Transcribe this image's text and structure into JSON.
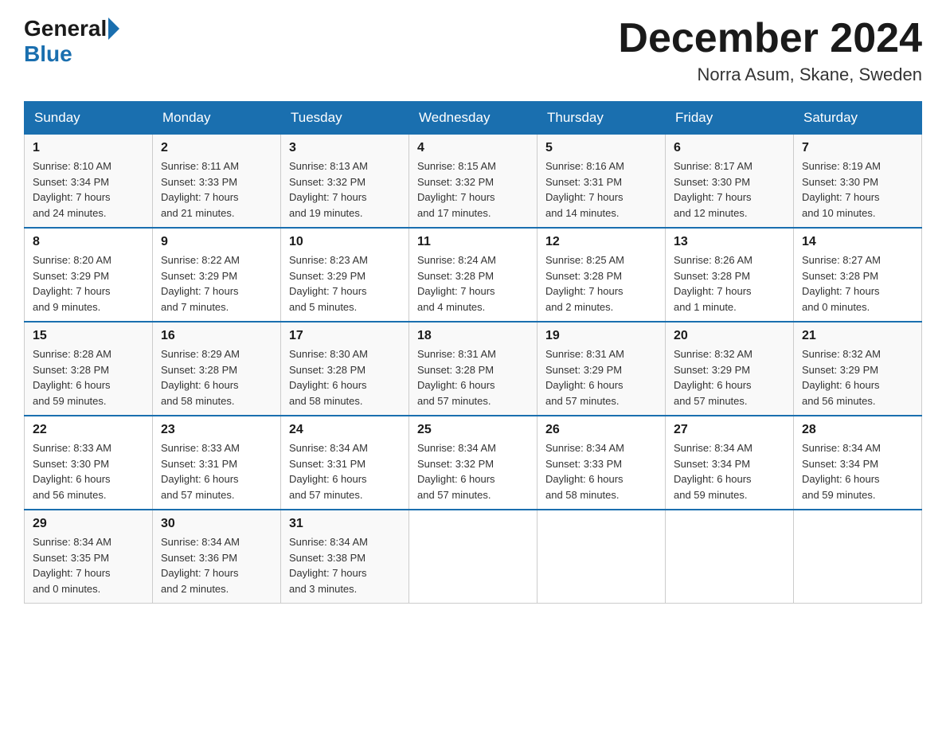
{
  "logo": {
    "general": "General",
    "blue": "Blue"
  },
  "title": "December 2024",
  "location": "Norra Asum, Skane, Sweden",
  "days_of_week": [
    "Sunday",
    "Monday",
    "Tuesday",
    "Wednesday",
    "Thursday",
    "Friday",
    "Saturday"
  ],
  "weeks": [
    [
      {
        "day": "1",
        "sunrise": "8:10 AM",
        "sunset": "3:34 PM",
        "daylight": "7 hours and 24 minutes."
      },
      {
        "day": "2",
        "sunrise": "8:11 AM",
        "sunset": "3:33 PM",
        "daylight": "7 hours and 21 minutes."
      },
      {
        "day": "3",
        "sunrise": "8:13 AM",
        "sunset": "3:32 PM",
        "daylight": "7 hours and 19 minutes."
      },
      {
        "day": "4",
        "sunrise": "8:15 AM",
        "sunset": "3:32 PM",
        "daylight": "7 hours and 17 minutes."
      },
      {
        "day": "5",
        "sunrise": "8:16 AM",
        "sunset": "3:31 PM",
        "daylight": "7 hours and 14 minutes."
      },
      {
        "day": "6",
        "sunrise": "8:17 AM",
        "sunset": "3:30 PM",
        "daylight": "7 hours and 12 minutes."
      },
      {
        "day": "7",
        "sunrise": "8:19 AM",
        "sunset": "3:30 PM",
        "daylight": "7 hours and 10 minutes."
      }
    ],
    [
      {
        "day": "8",
        "sunrise": "8:20 AM",
        "sunset": "3:29 PM",
        "daylight": "7 hours and 9 minutes."
      },
      {
        "day": "9",
        "sunrise": "8:22 AM",
        "sunset": "3:29 PM",
        "daylight": "7 hours and 7 minutes."
      },
      {
        "day": "10",
        "sunrise": "8:23 AM",
        "sunset": "3:29 PM",
        "daylight": "7 hours and 5 minutes."
      },
      {
        "day": "11",
        "sunrise": "8:24 AM",
        "sunset": "3:28 PM",
        "daylight": "7 hours and 4 minutes."
      },
      {
        "day": "12",
        "sunrise": "8:25 AM",
        "sunset": "3:28 PM",
        "daylight": "7 hours and 2 minutes."
      },
      {
        "day": "13",
        "sunrise": "8:26 AM",
        "sunset": "3:28 PM",
        "daylight": "7 hours and 1 minute."
      },
      {
        "day": "14",
        "sunrise": "8:27 AM",
        "sunset": "3:28 PM",
        "daylight": "7 hours and 0 minutes."
      }
    ],
    [
      {
        "day": "15",
        "sunrise": "8:28 AM",
        "sunset": "3:28 PM",
        "daylight": "6 hours and 59 minutes."
      },
      {
        "day": "16",
        "sunrise": "8:29 AM",
        "sunset": "3:28 PM",
        "daylight": "6 hours and 58 minutes."
      },
      {
        "day": "17",
        "sunrise": "8:30 AM",
        "sunset": "3:28 PM",
        "daylight": "6 hours and 58 minutes."
      },
      {
        "day": "18",
        "sunrise": "8:31 AM",
        "sunset": "3:28 PM",
        "daylight": "6 hours and 57 minutes."
      },
      {
        "day": "19",
        "sunrise": "8:31 AM",
        "sunset": "3:29 PM",
        "daylight": "6 hours and 57 minutes."
      },
      {
        "day": "20",
        "sunrise": "8:32 AM",
        "sunset": "3:29 PM",
        "daylight": "6 hours and 57 minutes."
      },
      {
        "day": "21",
        "sunrise": "8:32 AM",
        "sunset": "3:29 PM",
        "daylight": "6 hours and 56 minutes."
      }
    ],
    [
      {
        "day": "22",
        "sunrise": "8:33 AM",
        "sunset": "3:30 PM",
        "daylight": "6 hours and 56 minutes."
      },
      {
        "day": "23",
        "sunrise": "8:33 AM",
        "sunset": "3:31 PM",
        "daylight": "6 hours and 57 minutes."
      },
      {
        "day": "24",
        "sunrise": "8:34 AM",
        "sunset": "3:31 PM",
        "daylight": "6 hours and 57 minutes."
      },
      {
        "day": "25",
        "sunrise": "8:34 AM",
        "sunset": "3:32 PM",
        "daylight": "6 hours and 57 minutes."
      },
      {
        "day": "26",
        "sunrise": "8:34 AM",
        "sunset": "3:33 PM",
        "daylight": "6 hours and 58 minutes."
      },
      {
        "day": "27",
        "sunrise": "8:34 AM",
        "sunset": "3:34 PM",
        "daylight": "6 hours and 59 minutes."
      },
      {
        "day": "28",
        "sunrise": "8:34 AM",
        "sunset": "3:34 PM",
        "daylight": "6 hours and 59 minutes."
      }
    ],
    [
      {
        "day": "29",
        "sunrise": "8:34 AM",
        "sunset": "3:35 PM",
        "daylight": "7 hours and 0 minutes."
      },
      {
        "day": "30",
        "sunrise": "8:34 AM",
        "sunset": "3:36 PM",
        "daylight": "7 hours and 2 minutes."
      },
      {
        "day": "31",
        "sunrise": "8:34 AM",
        "sunset": "3:38 PM",
        "daylight": "7 hours and 3 minutes."
      },
      null,
      null,
      null,
      null
    ]
  ],
  "labels": {
    "sunrise": "Sunrise:",
    "sunset": "Sunset:",
    "daylight": "Daylight:"
  }
}
